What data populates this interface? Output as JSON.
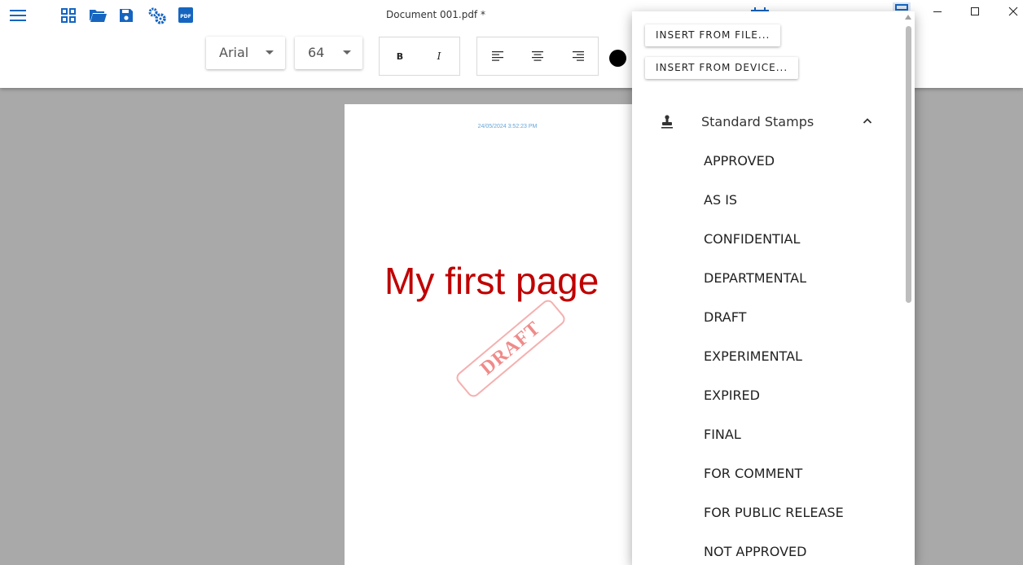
{
  "window": {
    "title": "Document 001.pdf *"
  },
  "toolbar": {
    "font_family": "Arial",
    "font_size": "64",
    "bold_label": "B",
    "italic_label": "I",
    "icons": [
      "menu-icon",
      "grid-icon",
      "folder-open-icon",
      "save-icon",
      "settings-icon",
      "pdf-icon"
    ],
    "text_color": "#000000",
    "accent_color": "#1565c0"
  },
  "page": {
    "timestamp": "24/05/2024 3:52:23 PM",
    "heading": "My first page",
    "heading_color": "#c00000",
    "stamp_text": "DRAFT"
  },
  "panel": {
    "insert_from_file": "INSERT FROM FILE...",
    "insert_from_device": "INSERT FROM DEVICE...",
    "section_title": "Standard Stamps",
    "stamps": [
      "APPROVED",
      "AS IS",
      "CONFIDENTIAL",
      "DEPARTMENTAL",
      "DRAFT",
      "EXPERIMENTAL",
      "EXPIRED",
      "FINAL",
      "FOR COMMENT",
      "FOR PUBLIC RELEASE",
      "NOT APPROVED"
    ]
  }
}
